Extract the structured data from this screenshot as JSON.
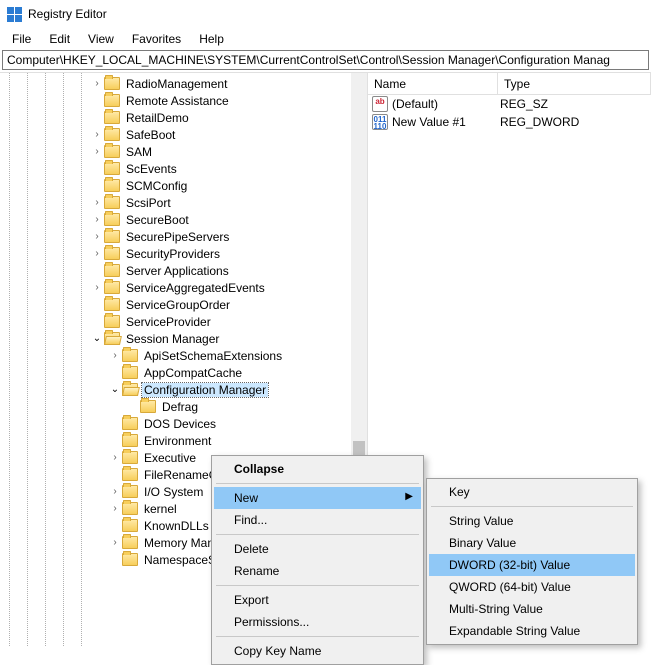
{
  "window": {
    "title": "Registry Editor"
  },
  "menu": {
    "file": "File",
    "edit": "Edit",
    "view": "View",
    "favorites": "Favorites",
    "help": "Help"
  },
  "address": "Computer\\HKEY_LOCAL_MACHINE\\SYSTEM\\CurrentControlSet\\Control\\Session Manager\\Configuration Manag",
  "tree": {
    "items": [
      {
        "depth": 5,
        "exp": ">",
        "label": "RadioManagement"
      },
      {
        "depth": 5,
        "exp": "",
        "label": "Remote Assistance"
      },
      {
        "depth": 5,
        "exp": "",
        "label": "RetailDemo"
      },
      {
        "depth": 5,
        "exp": ">",
        "label": "SafeBoot"
      },
      {
        "depth": 5,
        "exp": ">",
        "label": "SAM"
      },
      {
        "depth": 5,
        "exp": "",
        "label": "ScEvents"
      },
      {
        "depth": 5,
        "exp": "",
        "label": "SCMConfig"
      },
      {
        "depth": 5,
        "exp": ">",
        "label": "ScsiPort"
      },
      {
        "depth": 5,
        "exp": ">",
        "label": "SecureBoot"
      },
      {
        "depth": 5,
        "exp": ">",
        "label": "SecurePipeServers"
      },
      {
        "depth": 5,
        "exp": ">",
        "label": "SecurityProviders"
      },
      {
        "depth": 5,
        "exp": "",
        "label": "Server Applications"
      },
      {
        "depth": 5,
        "exp": ">",
        "label": "ServiceAggregatedEvents"
      },
      {
        "depth": 5,
        "exp": "",
        "label": "ServiceGroupOrder"
      },
      {
        "depth": 5,
        "exp": "",
        "label": "ServiceProvider"
      },
      {
        "depth": 5,
        "exp": "v",
        "label": "Session Manager",
        "open": true
      },
      {
        "depth": 6,
        "exp": ">",
        "label": "ApiSetSchemaExtensions"
      },
      {
        "depth": 6,
        "exp": "",
        "label": "AppCompatCache"
      },
      {
        "depth": 6,
        "exp": "v",
        "label": "Configuration Manager",
        "open": true,
        "selected": true,
        "truncate": true
      },
      {
        "depth": 7,
        "exp": "",
        "label": "Defrag"
      },
      {
        "depth": 6,
        "exp": "",
        "label": "DOS Devices"
      },
      {
        "depth": 6,
        "exp": "",
        "label": "Environment"
      },
      {
        "depth": 6,
        "exp": ">",
        "label": "Executive"
      },
      {
        "depth": 6,
        "exp": "",
        "label": "FileRenameOper"
      },
      {
        "depth": 6,
        "exp": ">",
        "label": "I/O System"
      },
      {
        "depth": 6,
        "exp": ">",
        "label": "kernel"
      },
      {
        "depth": 6,
        "exp": "",
        "label": "KnownDLLs"
      },
      {
        "depth": 6,
        "exp": ">",
        "label": "Memory Manage"
      },
      {
        "depth": 6,
        "exp": "",
        "label": "NamespaceSepa"
      }
    ]
  },
  "values": {
    "col_name": "Name",
    "col_type": "Type",
    "rows": [
      {
        "icon": "ab",
        "name": "(Default)",
        "type": "REG_SZ"
      },
      {
        "icon": "011\n110",
        "name": "New Value #1",
        "type": "REG_DWORD"
      }
    ]
  },
  "ctx1": {
    "collapse": "Collapse",
    "new": "New",
    "find": "Find...",
    "delete": "Delete",
    "rename": "Rename",
    "export": "Export",
    "permissions": "Permissions...",
    "copy": "Copy Key Name"
  },
  "ctx2": {
    "key": "Key",
    "string": "String Value",
    "binary": "Binary Value",
    "dword": "DWORD (32-bit) Value",
    "qword": "QWORD (64-bit) Value",
    "multi": "Multi-String Value",
    "expand": "Expandable String Value"
  }
}
